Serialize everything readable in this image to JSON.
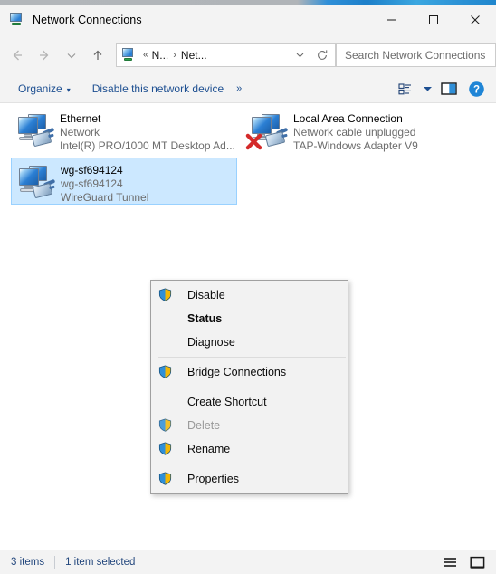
{
  "window": {
    "title": "Network Connections",
    "title_icon": "network-connections-icon",
    "minimize_label": "—",
    "maximize_label": "□",
    "close_label": "✕"
  },
  "nav": {
    "back_icon": "back-arrow-icon",
    "forward_icon": "forward-arrow-icon",
    "recent_icon": "chevron-down-icon",
    "up_icon": "up-arrow-icon",
    "address": {
      "icon": "network-connections-icon",
      "overflow": "«",
      "crumb1": "N...",
      "separator": "›",
      "crumb2": "Net...",
      "dropdown_icon": "chevron-down-icon",
      "refresh_icon": "refresh-icon"
    },
    "search": {
      "placeholder": "Search Network Connections",
      "value": ""
    }
  },
  "toolbar": {
    "organize_label": "Organize",
    "organize_caret": "▾",
    "disable_device_label": "Disable this network device",
    "overflow_label": "»",
    "view_options_icon": "view-options-icon",
    "view_caret": "▾",
    "preview_pane_icon": "preview-pane-icon",
    "help_icon": "help-icon",
    "help_glyph": "?"
  },
  "connections": [
    {
      "name": "Ethernet",
      "status": "Network",
      "adapter": "Intel(R) PRO/1000 MT Desktop Ad...",
      "icon": "network-adapter-icon",
      "selected": false,
      "error": false
    },
    {
      "name": "Local Area Connection",
      "status": "Network cable unplugged",
      "adapter": "TAP-Windows Adapter V9",
      "icon": "network-adapter-icon",
      "selected": false,
      "error": true,
      "error_icon": "red-x-error-icon"
    },
    {
      "name": "wg-sf694124",
      "status": "wg-sf694124",
      "adapter": "WireGuard Tunnel",
      "icon": "network-adapter-icon",
      "selected": true,
      "error": false
    }
  ],
  "context_menu": [
    {
      "label": "Disable",
      "icon": "uac-shield-icon",
      "bold": false,
      "disabled": false
    },
    {
      "label": "Status",
      "icon": "",
      "bold": true,
      "disabled": false
    },
    {
      "label": "Diagnose",
      "icon": "",
      "bold": false,
      "disabled": false
    },
    {
      "separator": true
    },
    {
      "label": "Bridge Connections",
      "icon": "uac-shield-icon",
      "bold": false,
      "disabled": false
    },
    {
      "separator": true
    },
    {
      "label": "Create Shortcut",
      "icon": "",
      "bold": false,
      "disabled": false
    },
    {
      "label": "Delete",
      "icon": "uac-shield-icon",
      "bold": false,
      "disabled": true
    },
    {
      "label": "Rename",
      "icon": "uac-shield-icon",
      "bold": false,
      "disabled": false
    },
    {
      "separator": true
    },
    {
      "label": "Properties",
      "icon": "uac-shield-icon",
      "bold": false,
      "disabled": false
    }
  ],
  "statusbar": {
    "item_count": "3 items",
    "selection": "1 item selected",
    "details_view_icon": "details-view-icon",
    "large_icons_view_icon": "large-icons-view-icon"
  },
  "colors": {
    "accent_blue": "#1d4f91",
    "selection_fill": "#cce8ff",
    "selection_border": "#99d1ff",
    "chrome_bg": "#f3f3f3",
    "menu_bg": "#f2f2f2",
    "status_text": "#23477d",
    "error_red": "#d42a2a",
    "shield_blue": "#2f8fd8",
    "shield_gold": "#f2b705"
  }
}
